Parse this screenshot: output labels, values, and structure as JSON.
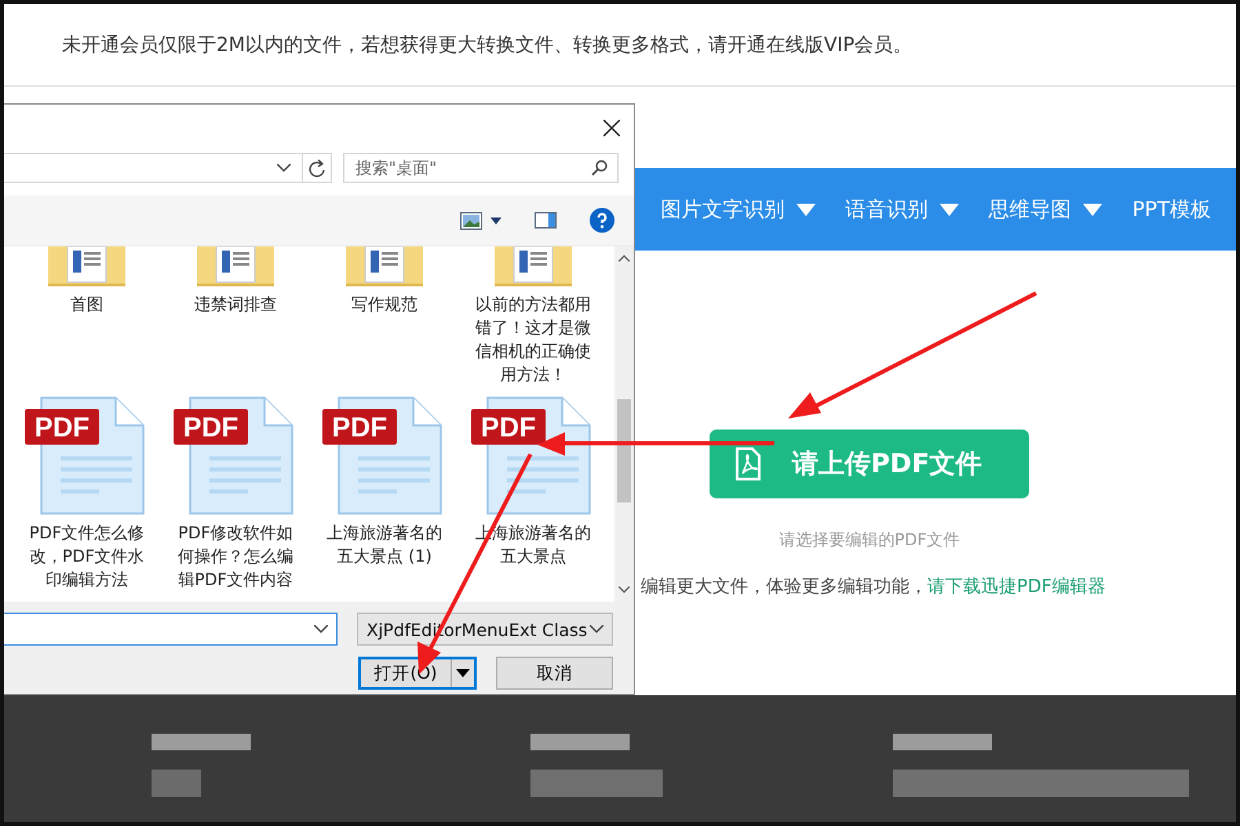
{
  "notice": "未开通会员仅限于2M以内的文件，若想获得更大转换文件、转换更多格式，请开通在线版VIP会员。",
  "nav": {
    "items": [
      {
        "label": "图片文字识别",
        "dropdown": true
      },
      {
        "label": "语音识别",
        "dropdown": true
      },
      {
        "label": "思维导图",
        "dropdown": true
      },
      {
        "label": "PPT模板",
        "dropdown": false
      }
    ]
  },
  "upload": {
    "button": "请上传PDF文件",
    "hint": "请选择要编辑的PDF文件",
    "note": "编辑更大文件，体验更多编辑功能，",
    "link": "请下载迅捷PDF编辑器"
  },
  "dialog": {
    "search": {
      "placeholder": "搜索\"桌面\""
    },
    "files": [
      {
        "name": "首图",
        "kind": "folder"
      },
      {
        "name": "违禁词排查",
        "kind": "folder"
      },
      {
        "name": "写作规范",
        "kind": "folder"
      },
      {
        "name": "以前的方法都用错了！这才是微信相机的正确使用方法！",
        "kind": "folder"
      },
      {
        "name": "PDF文件怎么修改，PDF文件水印编辑方法",
        "kind": "pdf",
        "badge": "PDF"
      },
      {
        "name": "PDF修改软件如何操作？怎么编辑PDF文件内容",
        "kind": "pdf",
        "badge": "PDF"
      },
      {
        "name": "上海旅游著名的五大景点 (1)",
        "kind": "pdf",
        "badge": "PDF"
      },
      {
        "name": "上海旅游著名的五大景点",
        "kind": "pdf",
        "badge": "PDF"
      }
    ],
    "file_type": "XjPdfEditorMenuExt Class",
    "buttons": [
      {
        "label": "打开(O)",
        "kind": "split"
      },
      {
        "label": "取消",
        "kind": "plain"
      }
    ]
  }
}
